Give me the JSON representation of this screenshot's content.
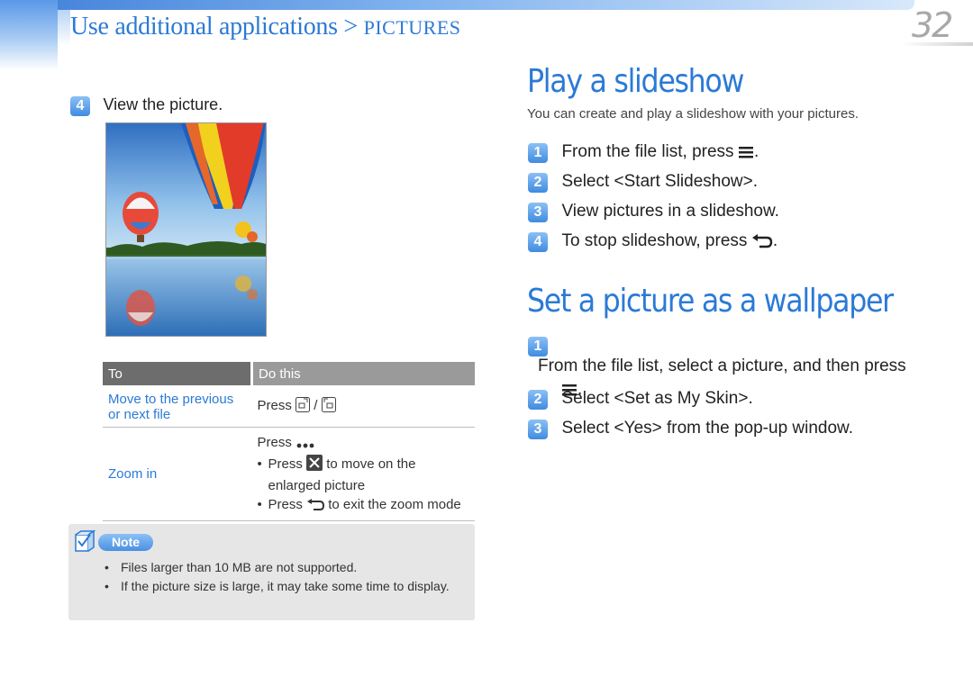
{
  "header": {
    "section_title": "Use additional applications > ",
    "section_sub": "PICTURES",
    "page_number": "32"
  },
  "left": {
    "step4_num": "4",
    "step4_text": "View the picture.",
    "table": {
      "col_to": "To",
      "col_do": "Do this",
      "row1_to_line1": "Move to the previous",
      "row1_to_line2": "or next file",
      "row1_do_prefix": "Press",
      "row1_do_sep": "/",
      "row2_to": "Zoom in",
      "row2_do_head": "Press",
      "row2_bullet1_a": "Press",
      "row2_bullet1_b": "to move on the",
      "row2_bullet1_c": "enlarged picture",
      "row2_bullet2_a": "Press",
      "row2_bullet2_b": "to exit the zoom mode"
    },
    "note": {
      "label": "Note",
      "items": [
        "Files larger than 10 MB are not supported.",
        "If the picture size is large, it may take some time to display."
      ]
    }
  },
  "right": {
    "slideshow": {
      "title": "Play a slideshow",
      "subtitle": "You can create and play a slideshow with your pictures.",
      "steps": [
        {
          "num": "1",
          "text_a": "From the file list, press",
          "text_b": "."
        },
        {
          "num": "2",
          "text_a": "Select <Start Slideshow>."
        },
        {
          "num": "3",
          "text_a": "View pictures in a slideshow."
        },
        {
          "num": "4",
          "text_a": "To stop slideshow, press",
          "text_b": "."
        }
      ]
    },
    "wallpaper": {
      "title": "Set a picture as a wallpaper",
      "steps": [
        {
          "num": "1",
          "text_a": "From the file list, select a picture, and then press",
          "text_b": "."
        },
        {
          "num": "2",
          "text_a": "Select <Set as My Skin>."
        },
        {
          "num": "3",
          "text_a": "Select <Yes> from the pop-up window."
        }
      ]
    }
  },
  "colors": {
    "accent": "#2b7ad6",
    "table_header_dark": "#6d6d6d",
    "table_header_light": "#9a9a9a",
    "note_bg": "#e6e6e6"
  },
  "icons": [
    "menu-icon",
    "back-icon",
    "prev-file-icon",
    "next-file-icon",
    "more-icon",
    "zoom-move-icon",
    "note-checkbox-icon"
  ]
}
